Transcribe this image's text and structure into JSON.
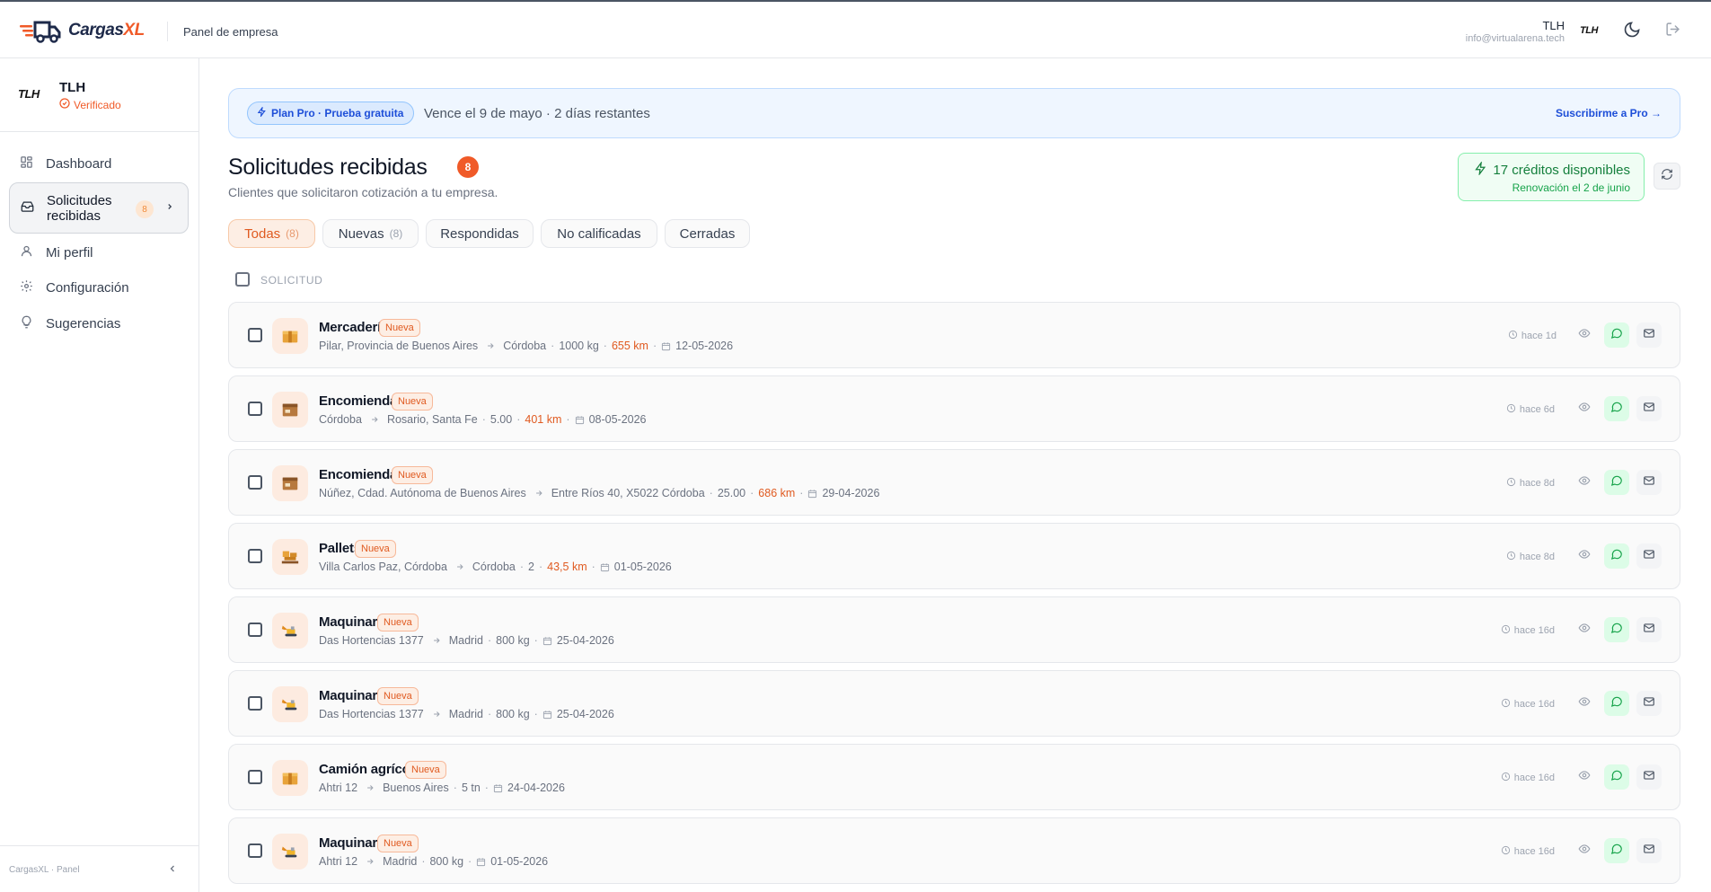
{
  "topbar": {
    "brand_main": "Cargas",
    "brand_accent": "XL",
    "section": "Panel de empresa",
    "user_name": "TLH",
    "user_email": "info@virtualarena.tech",
    "user_logo": "TLH"
  },
  "sidebar": {
    "company": {
      "logo": "TLH",
      "name": "TLH",
      "status": "Verificado"
    },
    "items": [
      {
        "label": "Dashboard",
        "icon": "grid-icon"
      },
      {
        "label": "Solicitudes recibidas",
        "icon": "inbox-icon",
        "badge": "8",
        "active": true
      },
      {
        "label": "Mi perfil",
        "icon": "user-icon"
      },
      {
        "label": "Configuración",
        "icon": "gear-icon"
      },
      {
        "label": "Sugerencias",
        "icon": "lightbulb-icon"
      }
    ],
    "footer": "CargasXL · Panel"
  },
  "banner": {
    "plan": "Plan Pro · Prueba gratuita",
    "text": "Vence el 9 de mayo · 2 días restantes",
    "cta": "Suscribirme a Pro →"
  },
  "page": {
    "title": "Solicitudes recibidas",
    "count": "8",
    "subtitle": "Clientes que solicitaron cotización a tu empresa."
  },
  "credits": {
    "main": "17 créditos disponibles",
    "sub": "Renovación el 2 de junio"
  },
  "tabs": [
    {
      "label": "Todas",
      "count": "(8)",
      "active": true
    },
    {
      "label": "Nuevas",
      "count": "(8)"
    },
    {
      "label": "Respondidas",
      "count": ""
    },
    {
      "label": "No calificadas",
      "count": ""
    },
    {
      "label": "Cerradas",
      "count": ""
    }
  ],
  "list_header": "SOLICITUD",
  "rows": [
    {
      "title": "Mercadería",
      "badge": "Nueva",
      "from": "Pilar, Provincia de Buenos Aires",
      "to": "Córdoba",
      "load": "1000 kg",
      "distance": "655 km",
      "date": "12-05-2026",
      "ago": "hace 1d",
      "icon": "box-icon"
    },
    {
      "title": "Encomiendas",
      "badge": "Nueva",
      "from": "Córdoba",
      "to": "Rosario, Santa Fe",
      "load": "5.00",
      "distance": "401 km",
      "date": "08-05-2026",
      "ago": "hace 6d",
      "icon": "parcel-icon"
    },
    {
      "title": "Encomiendas",
      "badge": "Nueva",
      "from": "Núñez, Cdad. Autónoma de Buenos Aires",
      "to": "Entre Ríos 40, X5022 Córdoba",
      "load": "25.00",
      "distance": "686 km",
      "date": "29-04-2026",
      "ago": "hace 8d",
      "icon": "parcel-icon"
    },
    {
      "title": "Pallets",
      "badge": "Nueva",
      "from": "Villa Carlos Paz, Córdoba",
      "to": "Córdoba",
      "load": "2",
      "distance": "43,5 km",
      "date": "01-05-2026",
      "ago": "hace 8d",
      "icon": "pallet-icon"
    },
    {
      "title": "Maquinaria",
      "badge": "Nueva",
      "from": "Das Hortencias 1377",
      "to": "Madrid",
      "load": "800 kg",
      "distance": "",
      "date": "25-04-2026",
      "ago": "hace 16d",
      "icon": "excavator-icon"
    },
    {
      "title": "Maquinaria",
      "badge": "Nueva",
      "from": "Das Hortencias 1377",
      "to": "Madrid",
      "load": "800 kg",
      "distance": "",
      "date": "25-04-2026",
      "ago": "hace 16d",
      "icon": "excavator-icon"
    },
    {
      "title": "Camión agrícola",
      "badge": "Nueva",
      "from": "Ahtri 12",
      "to": "Buenos Aires",
      "load": "5 tn",
      "distance": "",
      "date": "24-04-2026",
      "ago": "hace 16d",
      "icon": "box-icon"
    },
    {
      "title": "Maquinaria",
      "badge": "Nueva",
      "from": "Ahtri 12",
      "to": "Madrid",
      "load": "800 kg",
      "distance": "",
      "date": "01-05-2026",
      "ago": "hace 16d",
      "icon": "excavator-icon"
    }
  ],
  "colors": {
    "accent": "#f05a28",
    "blue": "#1d4ed8",
    "green": "#15803d"
  }
}
